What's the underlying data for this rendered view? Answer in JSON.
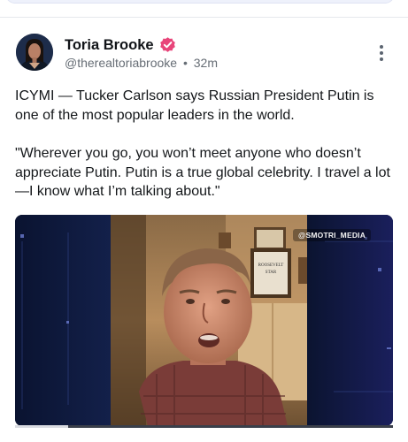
{
  "post": {
    "author": {
      "display_name": "Toria Brooke",
      "handle": "@therealtoriabrooke",
      "verified": true,
      "verified_color": "#e8457a"
    },
    "timestamp": "32m",
    "separator": "•",
    "text_paragraphs": [
      "ICYMI — Tucker Carlson says Russian President Putin is one of the most popular leaders in the world.",
      "\"Wherever you go, you won’t meet anyone who doesn’t appreciate Putin. Putin is a true global celebrity. I travel a lot—I know what I’m talking about.\""
    ],
    "media": {
      "type": "video",
      "watermark": "@SMOTRI_MEDIA",
      "progress": 0.14
    },
    "menu_icon": "more-vertical-icon"
  }
}
